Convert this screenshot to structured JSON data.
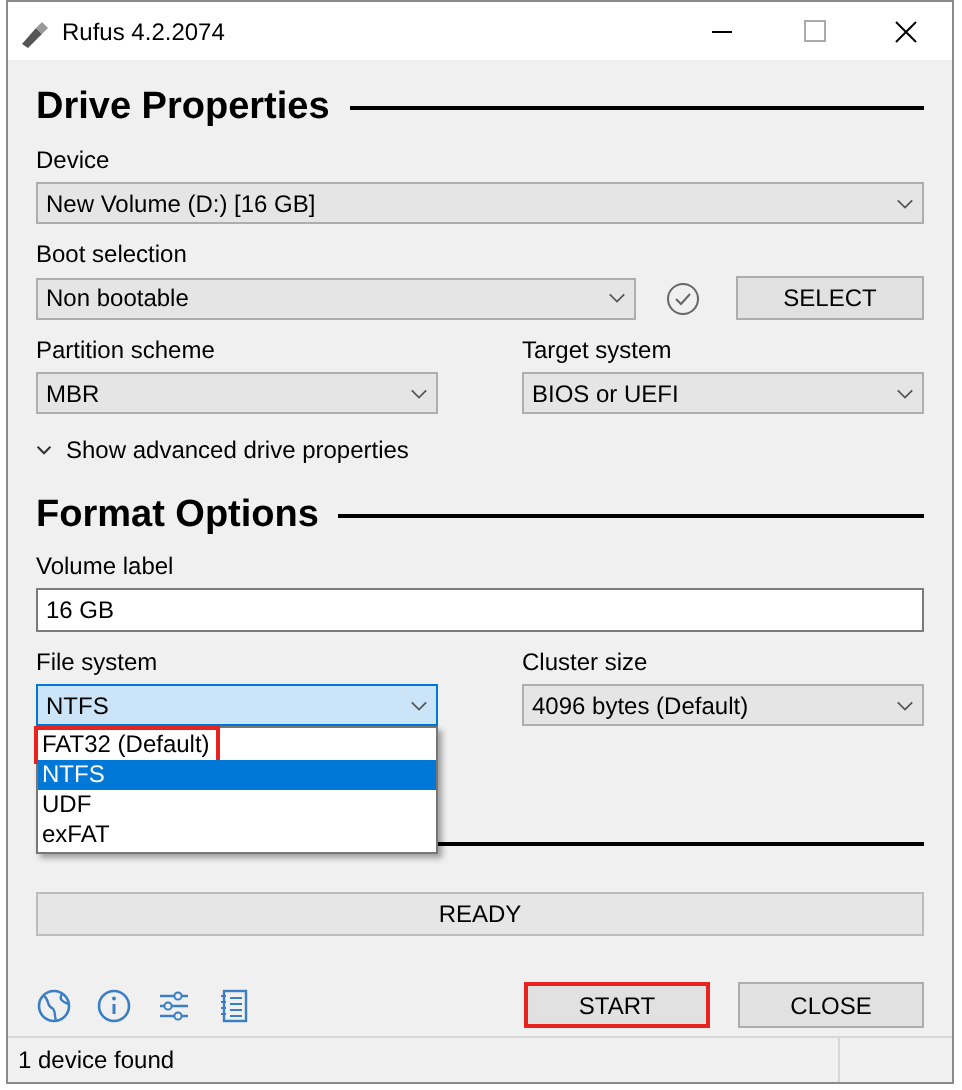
{
  "window": {
    "title": "Rufus 4.2.2074"
  },
  "drive_properties": {
    "heading": "Drive Properties",
    "device": {
      "label": "Device",
      "value": "New Volume (D:) [16 GB]"
    },
    "boot_selection": {
      "label": "Boot selection",
      "value": "Non bootable"
    },
    "select_button": {
      "label": "SELECT"
    },
    "partition_scheme": {
      "label": "Partition scheme",
      "value": "MBR"
    },
    "target_system": {
      "label": "Target system",
      "value": "BIOS or UEFI"
    },
    "advanced_toggle": {
      "label": "Show advanced drive properties",
      "expanded": false
    }
  },
  "format_options": {
    "heading": "Format Options",
    "volume_label": {
      "label": "Volume label",
      "value": "16 GB"
    },
    "file_system": {
      "label": "File system",
      "value": "NTFS",
      "open": true,
      "options": [
        {
          "label": "FAT32 (Default)",
          "selected": false,
          "highlighted": true
        },
        {
          "label": "NTFS",
          "selected": true,
          "highlighted": false
        },
        {
          "label": "UDF",
          "selected": false,
          "highlighted": false
        },
        {
          "label": "exFAT",
          "selected": false,
          "highlighted": false
        }
      ]
    },
    "cluster_size": {
      "label": "Cluster size",
      "value": "4096 bytes (Default)"
    }
  },
  "status": {
    "text": "READY"
  },
  "buttons": [
    {
      "label": "START",
      "highlighted": true
    },
    {
      "label": "CLOSE",
      "highlighted": false
    }
  ],
  "status_bar": {
    "text": "1 device found"
  }
}
